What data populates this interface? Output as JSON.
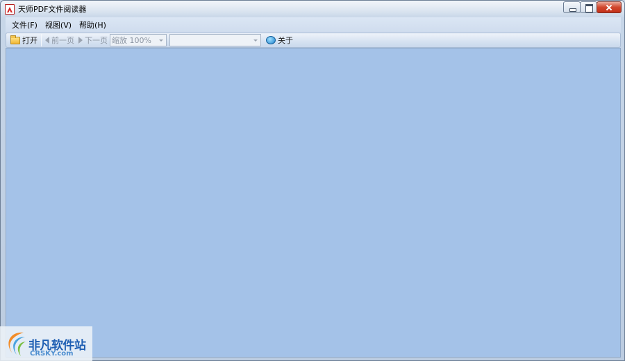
{
  "window": {
    "title": "天师PDF文件阅读器"
  },
  "menu": {
    "items": [
      {
        "label": "文件(F)"
      },
      {
        "label": "视图(V)"
      },
      {
        "label": "帮助(H)"
      }
    ]
  },
  "toolbar": {
    "open_label": "打开",
    "prev_label": "前一页",
    "next_label": "下一页",
    "zoom_value": "缩放 100%",
    "page_value": "",
    "about_label": "关于"
  },
  "watermark": {
    "cn": "非凡软件站",
    "en": "CRSKY.com"
  },
  "colors": {
    "viewer_bg": "#a4c2e8",
    "chrome_bg": "#c7d6e8"
  }
}
